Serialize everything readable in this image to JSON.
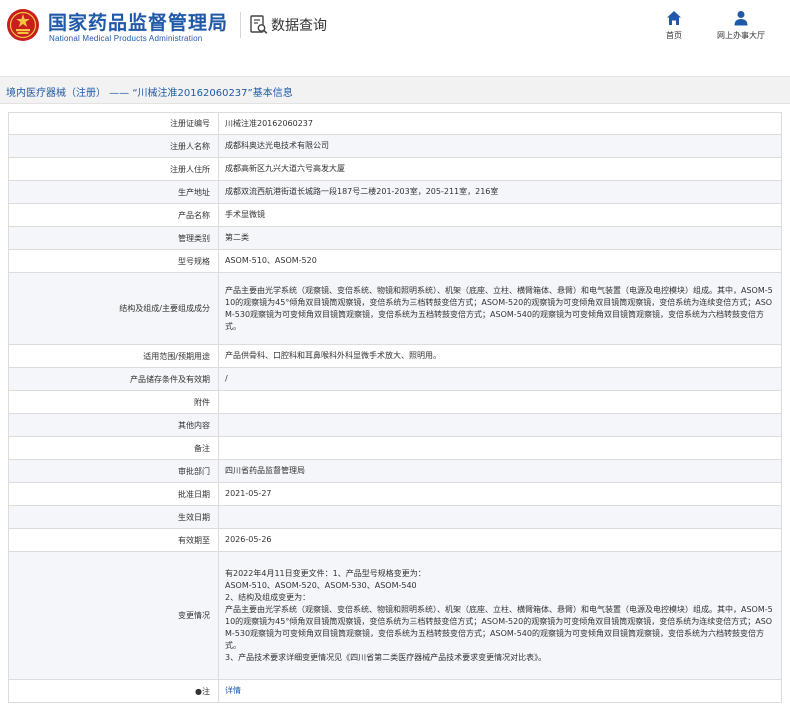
{
  "header": {
    "site_title": "国家药品监督管理局",
    "site_subtitle": "National Medical Products Administration",
    "query_title": "数据查询",
    "nav": {
      "home_label": "首页",
      "service_label": "网上办事大厅"
    }
  },
  "colors": {
    "brand_blue": "#1f59a8",
    "logo_red": "#c81e1e",
    "row_alt": "#f4f6f9"
  },
  "breadcrumb": {
    "category": "境内医疗器械（注册）",
    "separator": " —— ",
    "record": "“川械注准20162060237”基本信息"
  },
  "rows": [
    {
      "label": "注册证编号",
      "value": "川械注准20162060237"
    },
    {
      "label": "注册人名称",
      "value": "成都科奥达光电技术有限公司"
    },
    {
      "label": "注册人住所",
      "value": "成都高新区九兴大道六号高发大厦"
    },
    {
      "label": "生产地址",
      "value": "成都双流西航港街道长城路一段187号二楼201-203室，205-211室，216室"
    },
    {
      "label": "产品名称",
      "value": "手术显微镜"
    },
    {
      "label": "管理类别",
      "value": "第二类"
    },
    {
      "label": "型号规格",
      "value": "ASOM-510、ASOM-520"
    },
    {
      "label": "结构及组成/主要组成成分",
      "value": "产品主要由光学系统（观察镜、变倍系统、物镜和照明系统）、机架（底座、立柱、横臂箱体、悬臂）和电气装置（电源及电控模块）组成。其中，ASOM-510的观察镜为45°倾角双目镜筒观察镜，变倍系统为三档转鼓变倍方式；ASOM-520的观察镜为可变倾角双目镜筒观察镜，变倍系统为连续变倍方式；ASOM-530观察镜为可变倾角双目镜筒观察镜，变倍系统为五档转鼓变倍方式；ASOM-540的观察镜为可变倾角双目镜筒观察镜，变倍系统为六档转鼓变倍方式。"
    },
    {
      "label": "适用范围/预期用途",
      "value": "产品供骨科、口腔科和耳鼻喉科外科显微手术放大、照明用。"
    },
    {
      "label": "产品储存条件及有效期",
      "value": "/"
    },
    {
      "label": "附件",
      "value": ""
    },
    {
      "label": "其他内容",
      "value": ""
    },
    {
      "label": "备注",
      "value": ""
    },
    {
      "label": "审批部门",
      "value": "四川省药品监督管理局"
    },
    {
      "label": "批准日期",
      "value": "2021-05-27"
    },
    {
      "label": "生效日期",
      "value": ""
    },
    {
      "label": "有效期至",
      "value": "2026-05-26"
    }
  ],
  "change": {
    "label": "变更情况",
    "lines": [
      "有2022年4月11日变更文件：1、产品型号规格变更为：",
      "ASOM-510、ASOM-520、ASOM-530、ASOM-540",
      "2、结构及组成变更为：",
      "产品主要由光学系统（观察镜、变倍系统、物镜和照明系统）、机架（底座、立柱、横臂箱体、悬臂）和电气装置（电源及电控模块）组成。其中，ASOM-510的观察镜为45°倾角双目镜筒观察镜，变倍系统为三档转鼓变倍方式；ASOM-520的观察镜为可变倾角双目镜筒观察镜，变倍系统为连续变倍方式；ASOM-530观察镜为可变倾角双目镜筒观察镜，变倍系统为五档转鼓变倍方式；ASOM-540的观察镜为可变倾角双目镜筒观察镜，变倍系统为六档转鼓变倍方式。",
      "3、产品技术要求详细变更情况见《四川省第二类医疗器械产品技术要求变更情况对比表》。"
    ]
  },
  "note": {
    "label": "●注",
    "link": "详情"
  }
}
